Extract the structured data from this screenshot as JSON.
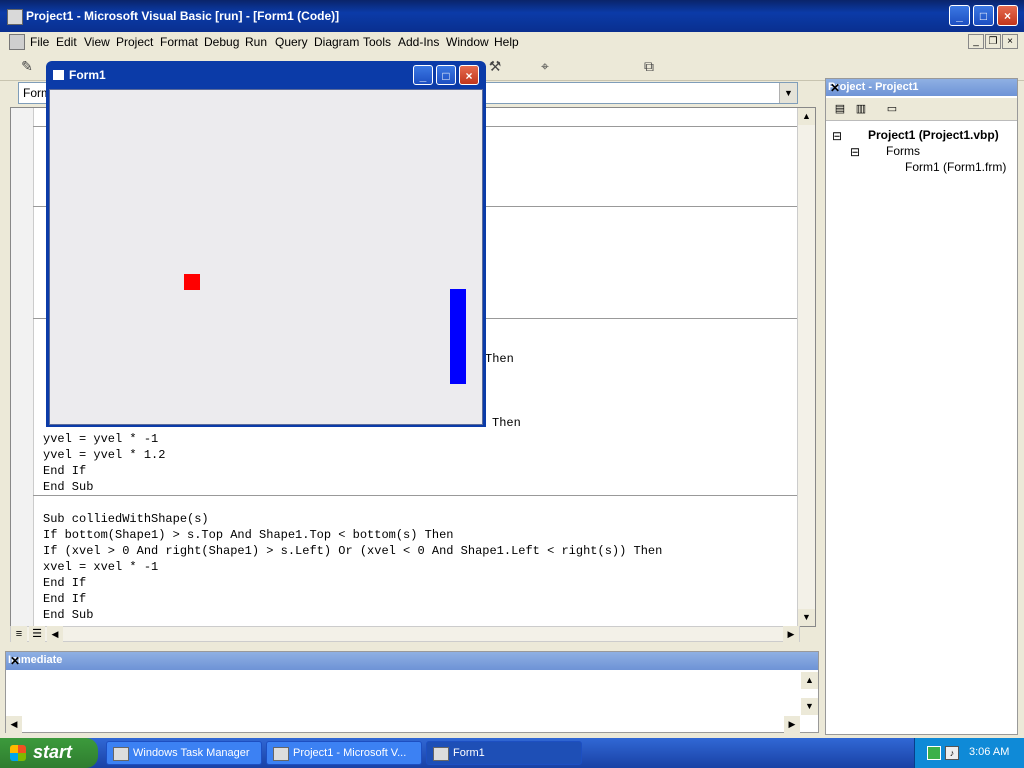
{
  "app": {
    "title": "Project1 - Microsoft Visual Basic [run] - [Form1 (Code)]",
    "window_controls": [
      "_",
      "□",
      "×"
    ]
  },
  "menu": [
    "File",
    "Edit",
    "View",
    "Project",
    "Format",
    "Debug",
    "Run",
    "Query",
    "Diagram",
    "Tools",
    "Add-Ins",
    "Window",
    "Help"
  ],
  "code_window": {
    "object_combo": "Form",
    "lines": [
      "Then",
      "Then",
      "yvel = yvel * -1",
      "yvel = yvel * 1.2",
      "End If",
      "End Sub",
      "Sub colliedWithShape(s)",
      "If bottom(Shape1) > s.Top And Shape1.Top < bottom(s) Then",
      "If (xvel > 0 And right(Shape1) > s.Left) Or (xvel < 0 And Shape1.Left < right(s)) Then",
      "xvel = xvel * -1",
      "End If",
      "End If",
      "End Sub"
    ]
  },
  "form1": {
    "title": "Form1",
    "ball_color": "#ff0000",
    "paddle_color": "#0000ff"
  },
  "project_panel": {
    "title": "Project - Project1",
    "project": "Project1 (Project1.vbp)",
    "folder": "Forms",
    "form": "Form1 (Form1.frm)"
  },
  "immediate": {
    "title": "Immediate"
  },
  "taskbar": {
    "start": "start",
    "tasks": [
      "Windows Task Manager",
      "Project1 - Microsoft V...",
      "Form1"
    ],
    "clock": "3:06 AM"
  }
}
